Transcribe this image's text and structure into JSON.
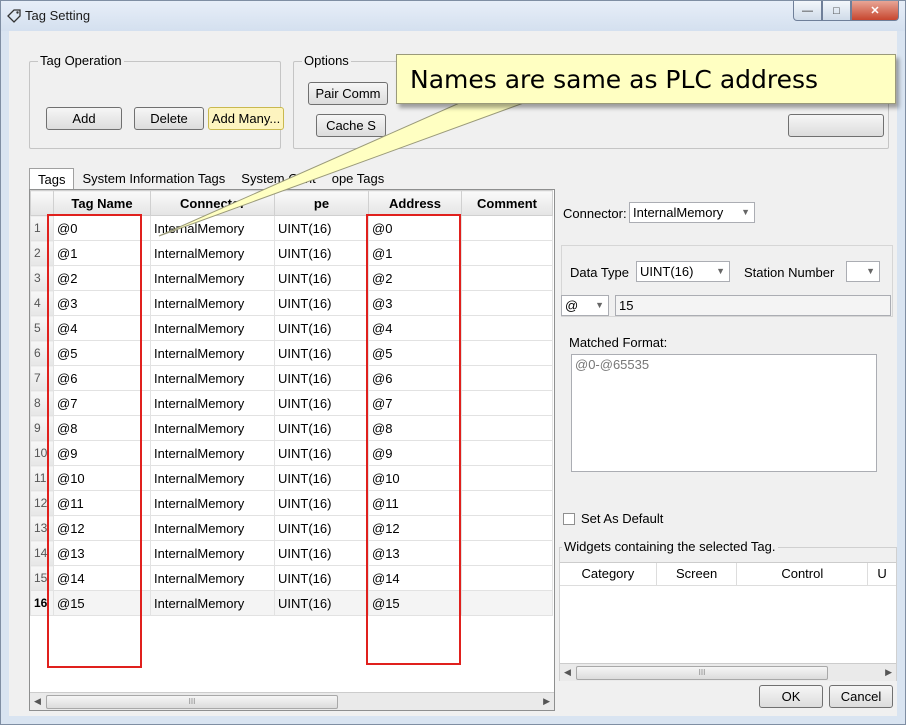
{
  "window": {
    "title": "Tag Setting"
  },
  "tag_operation": {
    "label": "Tag Operation",
    "add": "Add",
    "delete": "Delete",
    "add_many": "Add Many..."
  },
  "options": {
    "label": "Options",
    "pair_comm": "Pair Comm",
    "cache": "Cache S"
  },
  "callout": "Names are same as PLC address",
  "tabs": [
    "Tags",
    "System Information Tags",
    "System Cont",
    "ope Tags"
  ],
  "grid": {
    "columns": [
      "Tag Name",
      "Connector",
      "pe",
      "Address",
      "Comment"
    ],
    "rows": [
      {
        "n": "1",
        "name": "@0",
        "connector": "InternalMemory",
        "type": "UINT(16)",
        "address": "@0",
        "comment": ""
      },
      {
        "n": "2",
        "name": "@1",
        "connector": "InternalMemory",
        "type": "UINT(16)",
        "address": "@1",
        "comment": ""
      },
      {
        "n": "3",
        "name": "@2",
        "connector": "InternalMemory",
        "type": "UINT(16)",
        "address": "@2",
        "comment": ""
      },
      {
        "n": "4",
        "name": "@3",
        "connector": "InternalMemory",
        "type": "UINT(16)",
        "address": "@3",
        "comment": ""
      },
      {
        "n": "5",
        "name": "@4",
        "connector": "InternalMemory",
        "type": "UINT(16)",
        "address": "@4",
        "comment": ""
      },
      {
        "n": "6",
        "name": "@5",
        "connector": "InternalMemory",
        "type": "UINT(16)",
        "address": "@5",
        "comment": ""
      },
      {
        "n": "7",
        "name": "@6",
        "connector": "InternalMemory",
        "type": "UINT(16)",
        "address": "@6",
        "comment": ""
      },
      {
        "n": "8",
        "name": "@7",
        "connector": "InternalMemory",
        "type": "UINT(16)",
        "address": "@7",
        "comment": ""
      },
      {
        "n": "9",
        "name": "@8",
        "connector": "InternalMemory",
        "type": "UINT(16)",
        "address": "@8",
        "comment": ""
      },
      {
        "n": "10",
        "name": "@9",
        "connector": "InternalMemory",
        "type": "UINT(16)",
        "address": "@9",
        "comment": ""
      },
      {
        "n": "11",
        "name": "@10",
        "connector": "InternalMemory",
        "type": "UINT(16)",
        "address": "@10",
        "comment": ""
      },
      {
        "n": "12",
        "name": "@11",
        "connector": "InternalMemory",
        "type": "UINT(16)",
        "address": "@11",
        "comment": ""
      },
      {
        "n": "13",
        "name": "@12",
        "connector": "InternalMemory",
        "type": "UINT(16)",
        "address": "@12",
        "comment": ""
      },
      {
        "n": "14",
        "name": "@13",
        "connector": "InternalMemory",
        "type": "UINT(16)",
        "address": "@13",
        "comment": ""
      },
      {
        "n": "15",
        "name": "@14",
        "connector": "InternalMemory",
        "type": "UINT(16)",
        "address": "@14",
        "comment": ""
      },
      {
        "n": "16",
        "name": "@15",
        "connector": "InternalMemory",
        "type": "UINT(16)",
        "address": "@15",
        "comment": ""
      }
    ],
    "selected_row": "16"
  },
  "scroll_thumb_glyph": "III",
  "right_panel": {
    "connector_label": "Connector:",
    "connector_value": "InternalMemory",
    "data_type_label": "Data Type",
    "data_type_value": "UINT(16)",
    "station_number_label": "Station Number",
    "station_number_value": "",
    "prefix_value": "@",
    "address_value": "15",
    "matched_format_label": "Matched Format:",
    "matched_format_value": "@0-@65535",
    "set_as_default_label": "Set As Default",
    "widgets_label": "Widgets containing the selected Tag.",
    "widgets_columns": [
      "Category",
      "Screen",
      "Control",
      "U"
    ]
  },
  "footer": {
    "ok": "OK",
    "cancel": "Cancel"
  },
  "colors": {
    "highlight_box": "#e0201d",
    "callout_bg": "#ffffc2",
    "add_many_bg": "#fdf4bf"
  }
}
